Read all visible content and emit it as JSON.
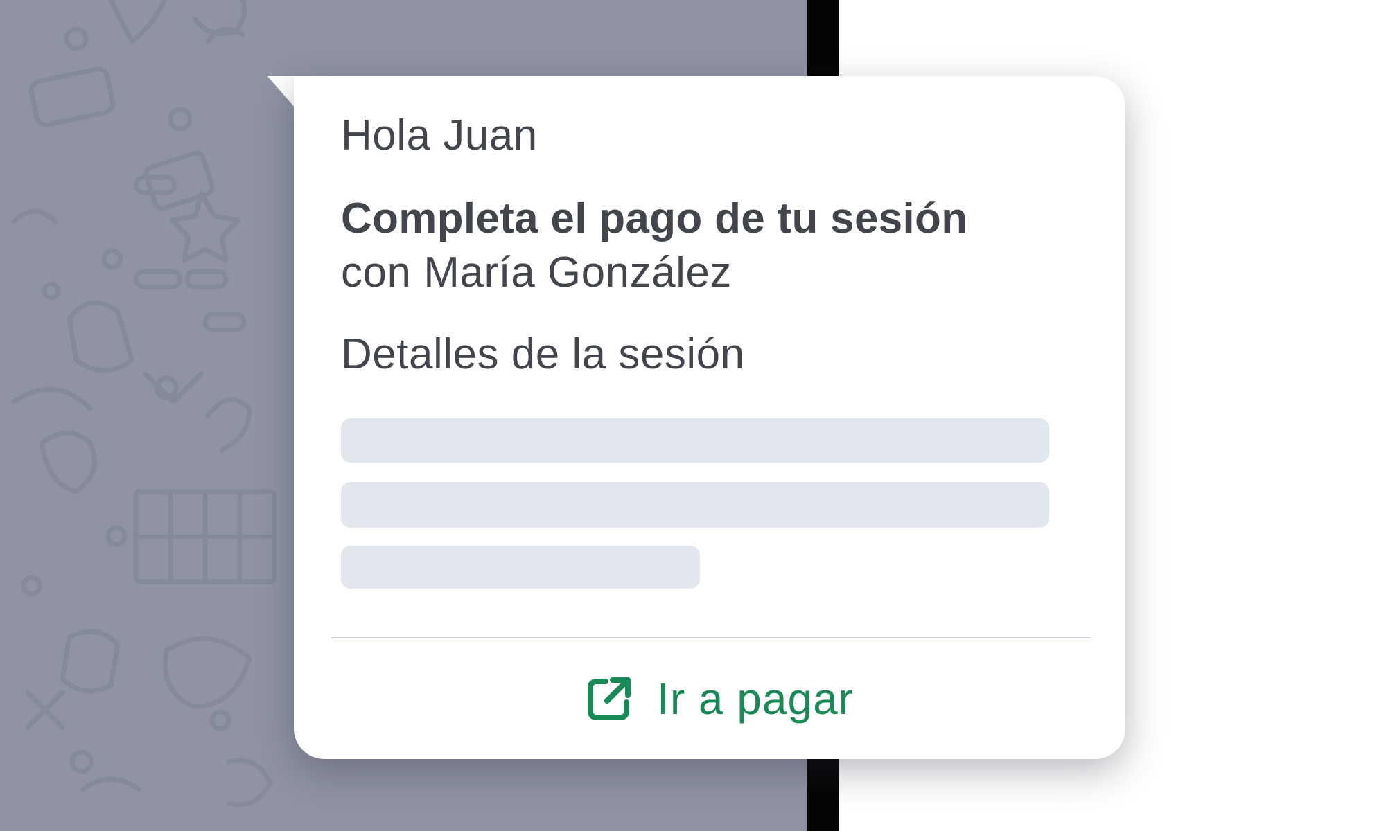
{
  "message": {
    "greeting": "Hola Juan",
    "title": "Completa el pago de tu sesión",
    "subtitle": "con María González",
    "details_label": "Detalles de la sesión"
  },
  "action": {
    "label": "Ir a pagar",
    "icon": "external-link-icon"
  },
  "colors": {
    "chat_background": "#8f93a3",
    "bubble_background": "#ffffff",
    "text": "#43454d",
    "skeleton": "#e2e7ef",
    "accent": "#188a55"
  }
}
